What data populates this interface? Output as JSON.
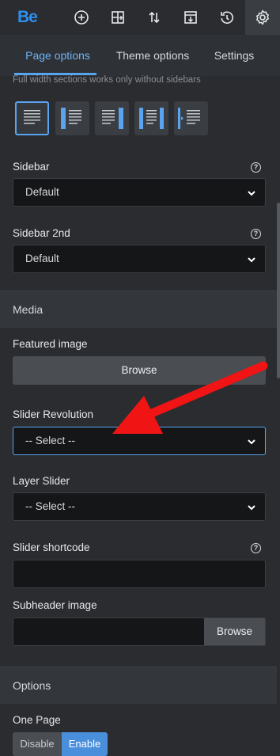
{
  "toolbar": {
    "logo": "Be",
    "icons": [
      "add-icon",
      "layout-add-icon",
      "sort-icon",
      "export-icon",
      "history-icon",
      "settings-icon"
    ]
  },
  "tabs": [
    {
      "label": "Page options",
      "active": true
    },
    {
      "label": "Theme options",
      "active": false
    },
    {
      "label": "Settings",
      "active": false
    }
  ],
  "layout": {
    "note": "Full width sections works only without sidebars",
    "options": [
      "full-width",
      "right-sidebar",
      "left-sidebar",
      "both-sidebars",
      "left-offset"
    ],
    "selected": 0
  },
  "fields": {
    "sidebar": {
      "label": "Sidebar",
      "value": "Default"
    },
    "sidebar2": {
      "label": "Sidebar 2nd",
      "value": "Default"
    }
  },
  "media": {
    "title": "Media",
    "featured_image": {
      "label": "Featured image",
      "button": "Browse"
    },
    "slider_revolution": {
      "label": "Slider Revolution",
      "value": "-- Select --"
    },
    "layer_slider": {
      "label": "Layer Slider",
      "value": "-- Select --"
    },
    "slider_shortcode": {
      "label": "Slider shortcode",
      "value": ""
    },
    "subheader_image": {
      "label": "Subheader image",
      "value": "",
      "button": "Browse"
    }
  },
  "options": {
    "title": "Options",
    "one_page": {
      "label": "One Page",
      "choices": [
        "Disable",
        "Enable"
      ],
      "selected": "Enable"
    }
  },
  "colors": {
    "accent": "#5aa3ef",
    "arrow": "#f01414",
    "background": "#2a2c2f"
  }
}
